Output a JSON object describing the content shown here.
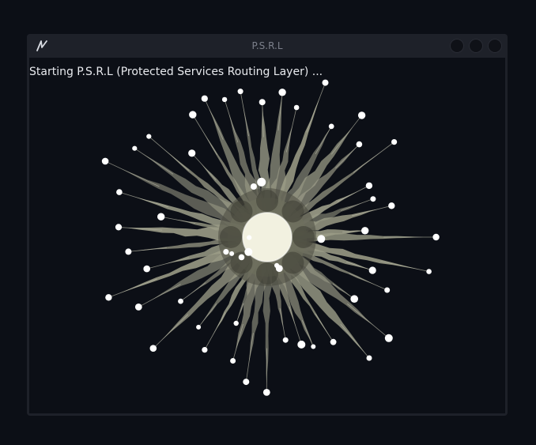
{
  "window": {
    "title": "P.S.R.L",
    "logo_icon": "app-logo-icon",
    "controls": [
      "minimize-button",
      "maximize-button",
      "close-button"
    ]
  },
  "content": {
    "status_text": "Starting P.S.R.L (Protected Services Routing Layer) ..."
  },
  "colors": {
    "background": "#0c0f16",
    "window": "#1e2129",
    "title_text": "#7c808b",
    "status_text": "#e8eaee",
    "burst": "#9c9d88",
    "core": "#f2f1e0",
    "particles": "#ffffff"
  }
}
